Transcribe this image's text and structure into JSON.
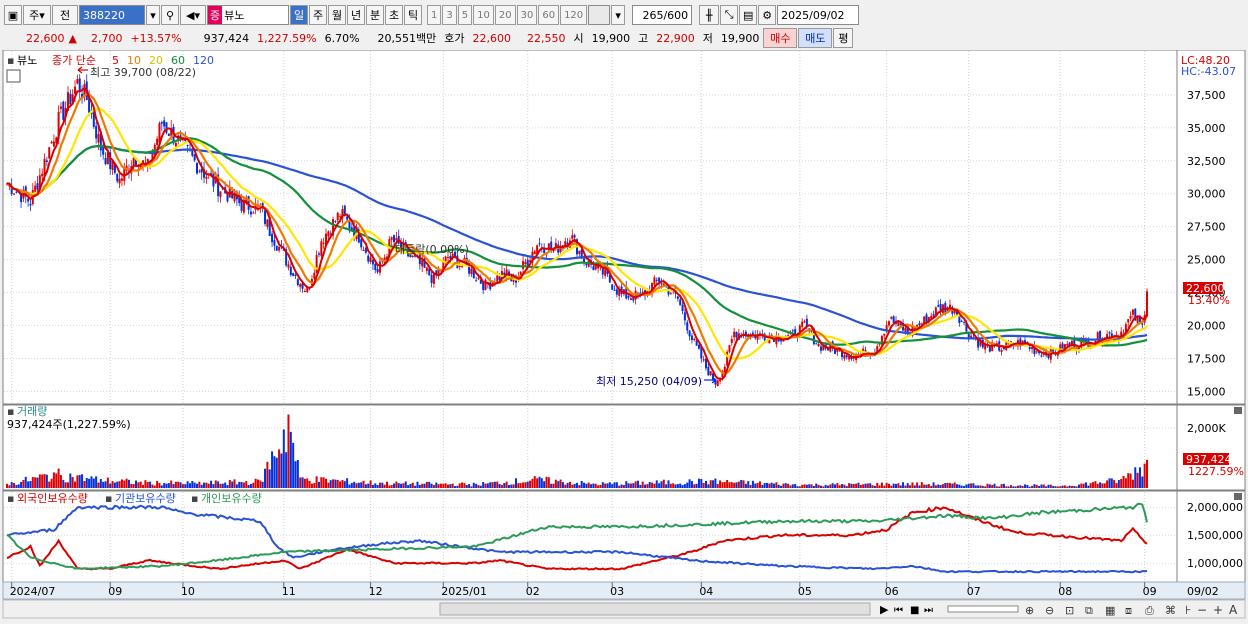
{
  "toolbar": {
    "market_code": "주",
    "prev_label": "전",
    "stock_code": "388220",
    "stock_name_badge": "증",
    "stock_name": "뷰노",
    "periods": [
      "일",
      "주",
      "월",
      "년",
      "분",
      "초",
      "틱"
    ],
    "selected_period": "일",
    "intervals": [
      "1",
      "3",
      "5",
      "10",
      "20",
      "30",
      "60",
      "120"
    ],
    "count": "265",
    "count_max": "/600",
    "date": "2025/09/02"
  },
  "quote": {
    "price": "22,600",
    "change": "2,700",
    "change_pct": "+13.57%",
    "volume": "937,424",
    "volume_ratio": "1,227.59%",
    "turnover": "6.70%",
    "amount": "20,551백만",
    "ask_label": "호가",
    "ask": "22,600",
    "bid": "22,550",
    "open_label": "시",
    "open": "19,900",
    "high_label": "고",
    "high": "22,900",
    "low_label": "저",
    "low": "19,900",
    "buy_label": "매수",
    "sell_label": "매도",
    "eval_label": "평"
  },
  "price_panel": {
    "title": "뷰노",
    "legend_prefix": "종가 단순",
    "ma_periods": [
      "5",
      "10",
      "20",
      "60",
      "120"
    ],
    "ma_colors": [
      "#d80000",
      "#f07a00",
      "#ffe600",
      "#13903a",
      "#2a52d8"
    ],
    "high_annot": "최고 39,700 (08/22)",
    "low_annot": "최저 15,250 (04/09)",
    "mid_annot": "대등락(0.00%)",
    "lc": "LC:48.20",
    "hc": "HC:-43.07",
    "last_price_box": "22,600",
    "last_pct": "13.40%"
  },
  "volume_panel": {
    "title": "거래량",
    "sub": "937,424주(1,227.59%)",
    "last_box": "937,424",
    "last_pct": "1227.59%"
  },
  "holding_panel": {
    "legend": [
      "외국인보유수량",
      "기관보유수량",
      "개인보유수량"
    ],
    "colors": [
      "#d80000",
      "#2a52d8",
      "#2e9a58"
    ]
  },
  "chart_data": {
    "type": "candlestick",
    "price_axis": {
      "ticks": [
        "37,500",
        "35,000",
        "32,500",
        "30,000",
        "27,500",
        "25,000",
        "22,500",
        "20,000",
        "17,500",
        "15,000"
      ],
      "range": [
        14200,
        40600
      ]
    },
    "volume_axis": {
      "ticks": [
        "2,000K"
      ],
      "range": [
        0,
        2700000
      ]
    },
    "holding_axis": {
      "ticks": [
        "2,000,000",
        "1,500,000",
        "1,000,000"
      ],
      "range": [
        700000,
        2200000
      ]
    },
    "x_labels": [
      "2024/07",
      "09",
      "10",
      "11",
      "12",
      "2025/01",
      "02",
      "03",
      "04",
      "05",
      "06",
      "07",
      "08",
      "09"
    ],
    "x_label_index": [
      2,
      44,
      75,
      118,
      155,
      186,
      222,
      258,
      296,
      338,
      375,
      410,
      449,
      485
    ],
    "right_x_label": "09/02",
    "key_closes": [
      {
        "i": 0,
        "v": 30800
      },
      {
        "i": 4,
        "v": 30200
      },
      {
        "i": 10,
        "v": 29400
      },
      {
        "i": 16,
        "v": 32400
      },
      {
        "i": 22,
        "v": 35500
      },
      {
        "i": 30,
        "v": 38400
      },
      {
        "i": 34,
        "v": 37200
      },
      {
        "i": 40,
        "v": 33500
      },
      {
        "i": 48,
        "v": 31000
      },
      {
        "i": 54,
        "v": 32800
      },
      {
        "i": 60,
        "v": 32000
      },
      {
        "i": 66,
        "v": 35400
      },
      {
        "i": 74,
        "v": 33800
      },
      {
        "i": 82,
        "v": 32000
      },
      {
        "i": 90,
        "v": 30500
      },
      {
        "i": 100,
        "v": 29200
      },
      {
        "i": 108,
        "v": 28900
      },
      {
        "i": 112,
        "v": 27200
      },
      {
        "i": 122,
        "v": 24000
      },
      {
        "i": 128,
        "v": 22600
      },
      {
        "i": 134,
        "v": 26500
      },
      {
        "i": 142,
        "v": 28500
      },
      {
        "i": 150,
        "v": 26800
      },
      {
        "i": 158,
        "v": 24000
      },
      {
        "i": 164,
        "v": 26500
      },
      {
        "i": 170,
        "v": 25500
      },
      {
        "i": 176,
        "v": 24600
      },
      {
        "i": 182,
        "v": 23500
      },
      {
        "i": 188,
        "v": 25200
      },
      {
        "i": 196,
        "v": 24500
      },
      {
        "i": 204,
        "v": 23000
      },
      {
        "i": 212,
        "v": 24000
      },
      {
        "i": 216,
        "v": 23300
      },
      {
        "i": 226,
        "v": 26200
      },
      {
        "i": 234,
        "v": 25800
      },
      {
        "i": 240,
        "v": 26900
      },
      {
        "i": 246,
        "v": 25000
      },
      {
        "i": 254,
        "v": 24000
      },
      {
        "i": 262,
        "v": 22300
      },
      {
        "i": 270,
        "v": 22200
      },
      {
        "i": 278,
        "v": 23500
      },
      {
        "i": 286,
        "v": 22000
      },
      {
        "i": 292,
        "v": 19000
      },
      {
        "i": 298,
        "v": 16800
      },
      {
        "i": 302,
        "v": 15700
      },
      {
        "i": 306,
        "v": 17000
      },
      {
        "i": 310,
        "v": 19500
      },
      {
        "i": 318,
        "v": 19300
      },
      {
        "i": 326,
        "v": 19200
      },
      {
        "i": 334,
        "v": 19100
      },
      {
        "i": 340,
        "v": 20000
      },
      {
        "i": 346,
        "v": 18500
      },
      {
        "i": 354,
        "v": 18100
      },
      {
        "i": 362,
        "v": 17700
      },
      {
        "i": 370,
        "v": 18200
      },
      {
        "i": 376,
        "v": 20500
      },
      {
        "i": 384,
        "v": 19500
      },
      {
        "i": 390,
        "v": 20200
      },
      {
        "i": 398,
        "v": 21400
      },
      {
        "i": 404,
        "v": 21300
      },
      {
        "i": 410,
        "v": 19400
      },
      {
        "i": 416,
        "v": 18400
      },
      {
        "i": 424,
        "v": 18300
      },
      {
        "i": 432,
        "v": 18700
      },
      {
        "i": 440,
        "v": 18000
      },
      {
        "i": 446,
        "v": 17900
      },
      {
        "i": 452,
        "v": 18500
      },
      {
        "i": 460,
        "v": 18700
      },
      {
        "i": 468,
        "v": 19300
      },
      {
        "i": 474,
        "v": 19300
      },
      {
        "i": 480,
        "v": 20800
      },
      {
        "i": 484,
        "v": 19900
      },
      {
        "i": 486,
        "v": 22600
      }
    ],
    "key_volumes": [
      {
        "i": 0,
        "v": 140000
      },
      {
        "i": 20,
        "v": 520000
      },
      {
        "i": 30,
        "v": 420000
      },
      {
        "i": 40,
        "v": 300000
      },
      {
        "i": 60,
        "v": 200000
      },
      {
        "i": 80,
        "v": 180000
      },
      {
        "i": 108,
        "v": 250000
      },
      {
        "i": 120,
        "v": 2450000
      },
      {
        "i": 125,
        "v": 350000
      },
      {
        "i": 140,
        "v": 280000
      },
      {
        "i": 160,
        "v": 180000
      },
      {
        "i": 200,
        "v": 140000
      },
      {
        "i": 226,
        "v": 320000
      },
      {
        "i": 250,
        "v": 150000
      },
      {
        "i": 300,
        "v": 260000
      },
      {
        "i": 340,
        "v": 120000
      },
      {
        "i": 380,
        "v": 160000
      },
      {
        "i": 410,
        "v": 140000
      },
      {
        "i": 450,
        "v": 80000
      },
      {
        "i": 475,
        "v": 300000
      },
      {
        "i": 486,
        "v": 937424
      }
    ],
    "holdings_series": [
      {
        "name": "외국인보유수량",
        "key": [
          [
            0,
            1100000
          ],
          [
            10,
            1300000
          ],
          [
            14,
            950000
          ],
          [
            22,
            1400000
          ],
          [
            30,
            900000
          ],
          [
            44,
            900000
          ],
          [
            60,
            1050000
          ],
          [
            90,
            900000
          ],
          [
            118,
            1050000
          ],
          [
            125,
            900000
          ],
          [
            145,
            1250000
          ],
          [
            165,
            1000000
          ],
          [
            200,
            1000000
          ],
          [
            210,
            1050000
          ],
          [
            230,
            900000
          ],
          [
            262,
            900000
          ],
          [
            292,
            1200000
          ],
          [
            305,
            1400000
          ],
          [
            330,
            1500000
          ],
          [
            360,
            1500000
          ],
          [
            375,
            1600000
          ],
          [
            386,
            1900000
          ],
          [
            400,
            2000000
          ],
          [
            412,
            1800000
          ],
          [
            430,
            1550000
          ],
          [
            460,
            1450000
          ],
          [
            475,
            1400000
          ],
          [
            480,
            1600000
          ],
          [
            486,
            1350000
          ]
        ]
      },
      {
        "name": "기관보유수량",
        "key": [
          [
            0,
            1500000
          ],
          [
            20,
            1600000
          ],
          [
            30,
            2000000
          ],
          [
            44,
            2000000
          ],
          [
            66,
            2000000
          ],
          [
            75,
            1900000
          ],
          [
            108,
            1750000
          ],
          [
            115,
            1300000
          ],
          [
            122,
            1100000
          ],
          [
            140,
            1250000
          ],
          [
            160,
            1350000
          ],
          [
            176,
            1400000
          ],
          [
            210,
            1200000
          ],
          [
            262,
            1200000
          ],
          [
            292,
            1050000
          ],
          [
            330,
            950000
          ],
          [
            370,
            900000
          ],
          [
            386,
            950000
          ],
          [
            400,
            850000
          ],
          [
            486,
            850000
          ]
        ]
      },
      {
        "name": "개인보유수량",
        "key": [
          [
            0,
            1500000
          ],
          [
            10,
            1100000
          ],
          [
            30,
            900000
          ],
          [
            66,
            950000
          ],
          [
            90,
            1050000
          ],
          [
            118,
            1200000
          ],
          [
            160,
            1250000
          ],
          [
            200,
            1300000
          ],
          [
            230,
            1650000
          ],
          [
            262,
            1650000
          ],
          [
            300,
            1700000
          ],
          [
            330,
            1750000
          ],
          [
            370,
            1750000
          ],
          [
            400,
            1850000
          ],
          [
            420,
            1800000
          ],
          [
            440,
            1900000
          ],
          [
            460,
            1950000
          ],
          [
            480,
            2000000
          ],
          [
            484,
            2050000
          ],
          [
            486,
            1750000
          ]
        ]
      }
    ]
  }
}
